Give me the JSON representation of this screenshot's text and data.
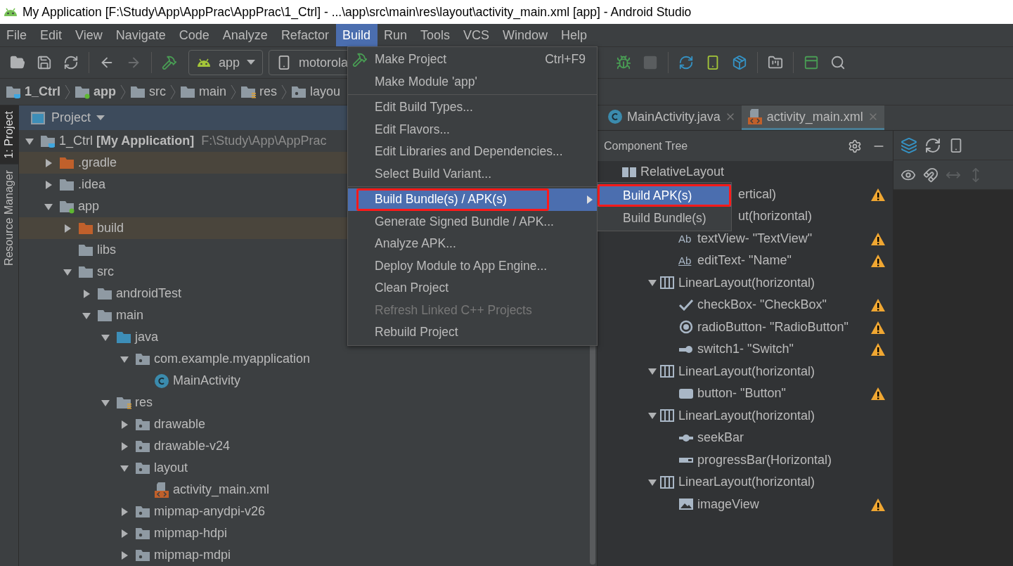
{
  "window": {
    "title": "My Application [F:\\Study\\App\\AppPrac\\AppPrac\\1_Ctrl] - ...\\app\\src\\main\\res\\layout\\activity_main.xml [app] - Android Studio"
  },
  "menu_bar": [
    {
      "label": "File",
      "selected": false
    },
    {
      "label": "Edit",
      "selected": false
    },
    {
      "label": "View",
      "selected": false
    },
    {
      "label": "Navigate",
      "selected": false
    },
    {
      "label": "Code",
      "selected": false
    },
    {
      "label": "Analyze",
      "selected": false
    },
    {
      "label": "Refactor",
      "selected": false
    },
    {
      "label": "Build",
      "selected": true
    },
    {
      "label": "Run",
      "selected": false
    },
    {
      "label": "Tools",
      "selected": false
    },
    {
      "label": "VCS",
      "selected": false
    },
    {
      "label": "Window",
      "selected": false
    },
    {
      "label": "Help",
      "selected": false
    }
  ],
  "toolbar": {
    "run_config": "app",
    "device": "motorola"
  },
  "breadcrumb": [
    {
      "label": "1_Ctrl",
      "kind": "project"
    },
    {
      "label": "app",
      "kind": "module"
    },
    {
      "label": "src",
      "kind": "folder"
    },
    {
      "label": "main",
      "kind": "folder"
    },
    {
      "label": "res",
      "kind": "resource"
    },
    {
      "label": "layou",
      "kind": "package"
    }
  ],
  "tool_strip": [
    {
      "label": "1: Project",
      "selected": true
    },
    {
      "label": "Resource Manager",
      "selected": false
    }
  ],
  "project_panel": {
    "title": "Project",
    "tree": [
      {
        "label": "1_Ctrl **[My Application]**",
        "path": "F:\\Study\\App\\AppPrac",
        "kind": "project",
        "expanded": true,
        "children": [
          {
            "label": ".gradle",
            "kind": "excluded",
            "expanded": false
          },
          {
            "label": ".idea",
            "kind": "folder",
            "expanded": false
          },
          {
            "label": "app",
            "kind": "module",
            "expanded": true,
            "children": [
              {
                "label": "build",
                "kind": "excluded",
                "expanded": false
              },
              {
                "label": "libs",
                "kind": "folder"
              },
              {
                "label": "src",
                "kind": "folder",
                "expanded": true,
                "children": [
                  {
                    "label": "androidTest",
                    "kind": "folder",
                    "expanded": false
                  },
                  {
                    "label": "main",
                    "kind": "folder",
                    "expanded": true,
                    "children": [
                      {
                        "label": "java",
                        "kind": "source",
                        "expanded": true,
                        "children": [
                          {
                            "label": "com.example.myapplication",
                            "kind": "package",
                            "expanded": true,
                            "children": [
                              {
                                "label": "MainActivity",
                                "kind": "class"
                              }
                            ]
                          }
                        ]
                      },
                      {
                        "label": "res",
                        "kind": "resource",
                        "expanded": true,
                        "children": [
                          {
                            "label": "drawable",
                            "kind": "package",
                            "expanded": false
                          },
                          {
                            "label": "drawable-v24",
                            "kind": "package",
                            "expanded": false
                          },
                          {
                            "label": "layout",
                            "kind": "package",
                            "expanded": true,
                            "children": [
                              {
                                "label": "activity_main.xml",
                                "kind": "layout-file"
                              }
                            ]
                          },
                          {
                            "label": "mipmap-anydpi-v26",
                            "kind": "package",
                            "expanded": false
                          },
                          {
                            "label": "mipmap-hdpi",
                            "kind": "package",
                            "expanded": false
                          },
                          {
                            "label": "mipmap-mdpi",
                            "kind": "package",
                            "expanded": false
                          }
                        ]
                      }
                    ]
                  }
                ]
              }
            ]
          }
        ]
      }
    ]
  },
  "editor_tabs": [
    {
      "label": "MainActivity.java",
      "kind": "class",
      "selected": false
    },
    {
      "label": "activity_main.xml",
      "kind": "layout-file",
      "selected": true
    }
  ],
  "component_tree": {
    "title": "Component Tree",
    "tree": [
      {
        "label": "RelativeLayout",
        "kind": "relative-layout",
        "children": [
          {
            "label": "ertical)",
            "covered": true,
            "warning": true,
            "children": [
              {
                "label": "ut(horizontal)",
                "covered": true,
                "children": [
                  {
                    "label": "textView- \"TextView\"",
                    "kind": "text-view",
                    "glyph": "Ab",
                    "warning": true
                  },
                  {
                    "label": "editText- \"Name\"",
                    "kind": "edit-text",
                    "glyph": "Ab",
                    "warning": true
                  }
                ]
              },
              {
                "label": "LinearLayout(horizontal)",
                "kind": "linear-layout",
                "expanded": true,
                "warning": false,
                "children": [
                  {
                    "label": "checkBox- \"CheckBox\"",
                    "kind": "check-box",
                    "warning": true
                  },
                  {
                    "label": "radioButton- \"RadioButton\"",
                    "kind": "radio-button",
                    "warning": true
                  },
                  {
                    "label": "switch1- \"Switch\"",
                    "kind": "switch",
                    "warning": true
                  }
                ]
              },
              {
                "label": "LinearLayout(horizontal)",
                "kind": "linear-layout",
                "expanded": true,
                "warning": false,
                "children": [
                  {
                    "label": "button- \"Button\"",
                    "kind": "button",
                    "warning": true
                  }
                ]
              },
              {
                "label": "LinearLayout(horizontal)",
                "kind": "linear-layout",
                "expanded": true,
                "warning": false,
                "children": [
                  {
                    "label": "seekBar",
                    "kind": "seek-bar",
                    "warning": false
                  },
                  {
                    "label": "progressBar(Horizontal)",
                    "kind": "progress-bar",
                    "warning": false
                  }
                ]
              },
              {
                "label": "LinearLayout(horizontal)",
                "kind": "linear-layout",
                "expanded": true,
                "warning": false,
                "children": [
                  {
                    "label": "imageView",
                    "kind": "image-view",
                    "warning": true
                  }
                ]
              }
            ]
          }
        ]
      }
    ]
  },
  "build_menu": [
    {
      "kind": "build",
      "label": "Make Project",
      "shortcut": "Ctrl+F9",
      "selected": false,
      "disabled": false
    },
    {
      "kind": "item",
      "label": "Make Module 'app'",
      "selected": false,
      "disabled": false
    },
    {
      "kind": "separator"
    },
    {
      "kind": "item",
      "label": "Edit Build Types...",
      "selected": false,
      "disabled": false
    },
    {
      "kind": "item",
      "label": "Edit Flavors...",
      "selected": false,
      "disabled": false
    },
    {
      "kind": "item",
      "label": "Edit Libraries and Dependencies...",
      "selected": false,
      "disabled": false
    },
    {
      "kind": "item",
      "label": "Select Build Variant...",
      "selected": false,
      "disabled": false
    },
    {
      "kind": "separator"
    },
    {
      "kind": "submenu",
      "label": "Build Bundle(s) / APK(s)",
      "selected": true,
      "disabled": false,
      "highlighted": true
    },
    {
      "kind": "item",
      "label": "Generate Signed Bundle / APK...",
      "selected": false,
      "disabled": false
    },
    {
      "kind": "item",
      "label": "Analyze APK...",
      "selected": false,
      "disabled": false
    },
    {
      "kind": "item",
      "label": "Deploy Module to App Engine...",
      "selected": false,
      "disabled": false
    },
    {
      "kind": "item",
      "label": "Clean Project",
      "selected": false,
      "disabled": false
    },
    {
      "kind": "item",
      "label": "Refresh Linked C++ Projects",
      "selected": false,
      "disabled": true
    },
    {
      "kind": "item",
      "label": "Rebuild Project",
      "selected": false,
      "disabled": false
    }
  ],
  "submenu": [
    {
      "label": "Build APK(s)",
      "selected": true,
      "highlighted": true
    },
    {
      "label": "Build Bundle(s)",
      "selected": false,
      "highlighted": false
    }
  ]
}
